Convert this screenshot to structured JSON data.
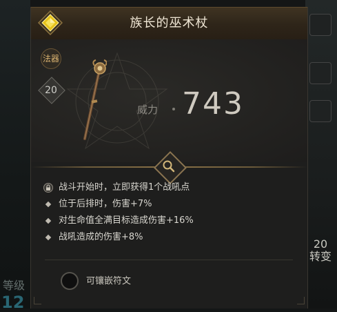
{
  "item": {
    "name": "族长的巫术杖",
    "type_tag": "法器",
    "level": "20",
    "power_label": "威力",
    "power_value": "743"
  },
  "effects": [
    {
      "icon": "lock-icon",
      "text": "战斗开始时，立即获得1个战吼点"
    },
    {
      "icon": "bullet",
      "text": "位于后排时，伤害+7%"
    },
    {
      "icon": "bullet",
      "text": "对生命值全满目标造成伤害+16%"
    },
    {
      "icon": "bullet",
      "text": "战吼造成的伤害+8%"
    }
  ],
  "socket": {
    "label": "可镶嵌符文"
  },
  "background": {
    "level_label": "等级",
    "level_value": "12",
    "right_badge_num": "20",
    "right_badge_text": "转变"
  },
  "colors": {
    "rarity": "#e6c21a",
    "title_text": "#efe6d4",
    "accent_gold": "#8c7347"
  }
}
